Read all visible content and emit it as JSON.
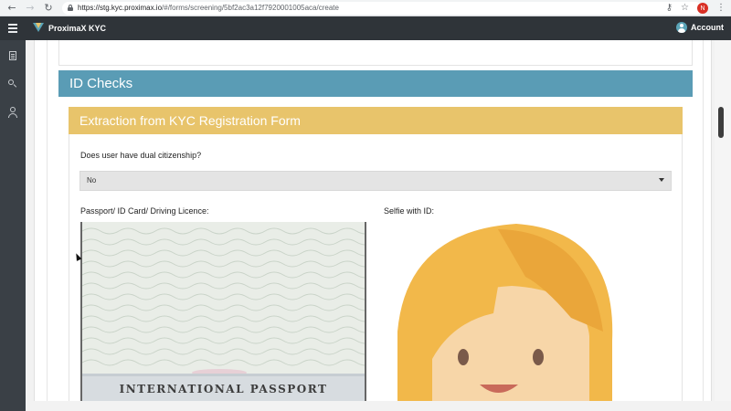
{
  "browser": {
    "url_host": "https://stg.kyc.proximax.io",
    "url_rest": "/#/forms/screening/5bf2ac3a12f7920001005aca/create",
    "profile_initial": "N",
    "icons": [
      "back-arrow-icon",
      "forward-arrow-icon",
      "reload-icon",
      "lock-icon",
      "key-icon",
      "star-icon",
      "more-vert-icon"
    ]
  },
  "header": {
    "app_title": "ProximaX KYC",
    "account_label": "Account"
  },
  "sidebar": {
    "icons": [
      "document-icon",
      "search-icon",
      "user-icon"
    ]
  },
  "main": {
    "section_title": "ID Checks",
    "subsection_title": "Extraction from KYC Registration Form",
    "dual_citizenship_question": "Does user have dual citizenship?",
    "dual_citizenship_value": "No",
    "passport_label": "Passport/ ID Card/ Driving Licence:",
    "selfie_label": "Selfie with ID:",
    "passport_image_text": "INTERNATIONAL PASSPORT"
  },
  "colors": {
    "header_bg": "#2f3439",
    "sidebar_bg": "#3a4046",
    "id_checks_bg": "#5a9cb5",
    "subsection_bg": "#e8c46b",
    "hair": "#f2b84a",
    "skin": "#f7d6a8"
  }
}
